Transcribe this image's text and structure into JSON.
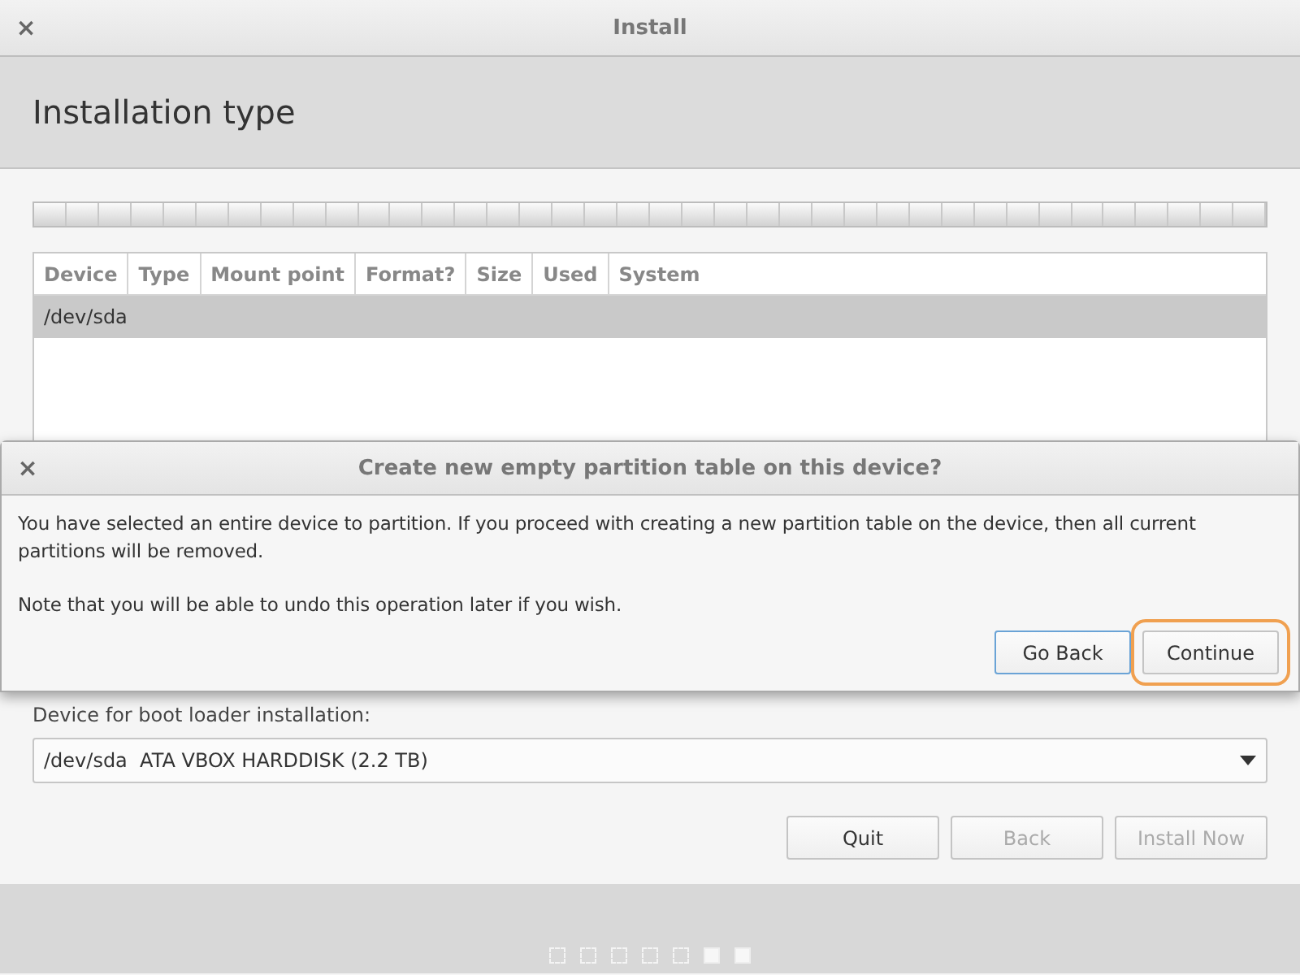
{
  "window": {
    "title": "Install",
    "close": "×"
  },
  "header": {
    "title": "Installation type"
  },
  "table": {
    "columns": [
      "Device",
      "Type",
      "Mount point",
      "Format?",
      "Size",
      "Used",
      "System"
    ],
    "rows": [
      {
        "cells": [
          "/dev/sda"
        ],
        "selected": true
      }
    ]
  },
  "boot_loader": {
    "label": "Device for boot loader installation:",
    "value": "/dev/sda  ATA VBOX HARDDISK (2.2 TB)"
  },
  "buttons": [
    {
      "label": "Quit",
      "disabled": false
    },
    {
      "label": "Back",
      "disabled": true
    },
    {
      "label": "Install Now",
      "disabled": true
    }
  ],
  "steps": [
    {
      "done": false
    },
    {
      "done": false
    },
    {
      "done": false
    },
    {
      "done": false
    },
    {
      "done": false
    },
    {
      "done": true
    },
    {
      "done": true
    }
  ],
  "dialog": {
    "title": "Create new empty partition table on this device?",
    "close": "×",
    "paragraphs": [
      "You have selected an entire device to partition. If you proceed with creating a new partition table on the device, then all current partitions will be removed.",
      "Note that you will be able to undo this operation later if you wish."
    ],
    "buttons": [
      {
        "label": "Go Back",
        "focused": true,
        "highlighted": false
      },
      {
        "label": "Continue",
        "focused": false,
        "highlighted": true
      }
    ]
  }
}
